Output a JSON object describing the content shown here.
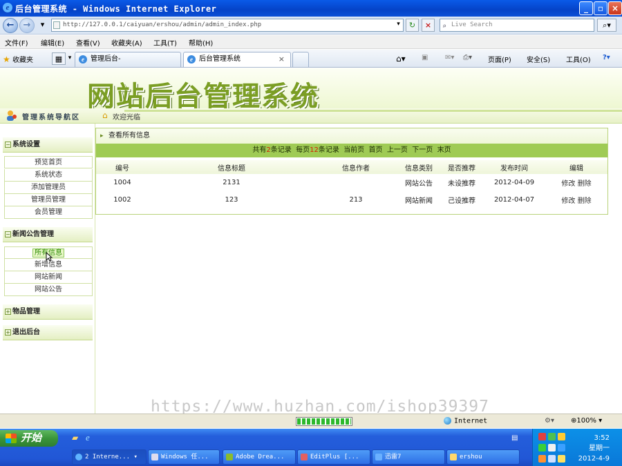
{
  "window": {
    "title": "后台管理系统 - Windows Internet Explorer"
  },
  "address_bar": {
    "url": "http://127.0.0.1/caiyuan/ershou/admin/admin_index.php",
    "search_placeholder": "Live Search"
  },
  "menu": [
    "文件(F)",
    "编辑(E)",
    "查看(V)",
    "收藏夹(A)",
    "工具(T)",
    "帮助(H)"
  ],
  "tabs_bar": {
    "favorites": "收藏夹",
    "tabs": [
      {
        "label": "管理后台-"
      },
      {
        "label": "后台管理系统",
        "close": "×"
      }
    ],
    "tools": [
      "页面(P)",
      "安全(S)",
      "工具(O)"
    ]
  },
  "page": {
    "banner_title": "网站后台管理系统",
    "nav_label": "管理系统导航区",
    "welcome": "欢迎光临",
    "sidebar": {
      "groups": [
        {
          "title": "系统设置",
          "items": [
            "预览首页",
            "系统状态",
            "添加管理员",
            "管理员管理",
            "会员管理"
          ]
        },
        {
          "title": "新闻公告管理",
          "items": [
            "所有信息",
            "新增信息",
            "网站新闻",
            "网站公告"
          ]
        },
        {
          "title": "物品管理",
          "items": []
        },
        {
          "title": "退出后台",
          "items": []
        }
      ]
    },
    "panel": {
      "header": "查看所有信息",
      "pager": {
        "total_prefix": "共有",
        "total": "2",
        "total_suffix": "条记录",
        "per_page_prefix": "每页",
        "per_page": "12",
        "per_page_suffix": "条记录",
        "current": "当前页",
        "first": "首页",
        "prev": "上一页",
        "next": "下一页",
        "last": "末页"
      },
      "columns": [
        "编号",
        "信息标题",
        "信息作者",
        "信息类别",
        "是否推荐",
        "发布时间",
        "编辑"
      ],
      "rows": [
        {
          "id": "1004",
          "title": "2131",
          "author": "",
          "category": "网站公告",
          "recommend": "未设推荐",
          "date": "2012-04-09",
          "edit": "修改",
          "delete": "删除"
        },
        {
          "id": "1002",
          "title": "123",
          "author": "213",
          "category": "网站新闻",
          "recommend": "己设推荐",
          "date": "2012-04-07",
          "edit": "修改",
          "delete": "删除"
        }
      ]
    }
  },
  "watermark": "https://www.huzhan.com/ishop39397",
  "status_bar": {
    "zone": "Internet",
    "zoom": "100%"
  },
  "taskbar": {
    "start": "开始",
    "buttons": [
      "2 Interne...",
      "Windows 任...",
      "Adobe Drea...",
      "EditPlus [...",
      "迅雷7",
      "ershou"
    ],
    "clock_time": "3:52",
    "clock_day": "星期一",
    "clock_date": "2012-4-9"
  },
  "colors": {
    "accent_green": "#9fcb55",
    "title_green": "#7b9e24",
    "recommended_red": "#d40000",
    "xp_blue": "#245edb"
  }
}
